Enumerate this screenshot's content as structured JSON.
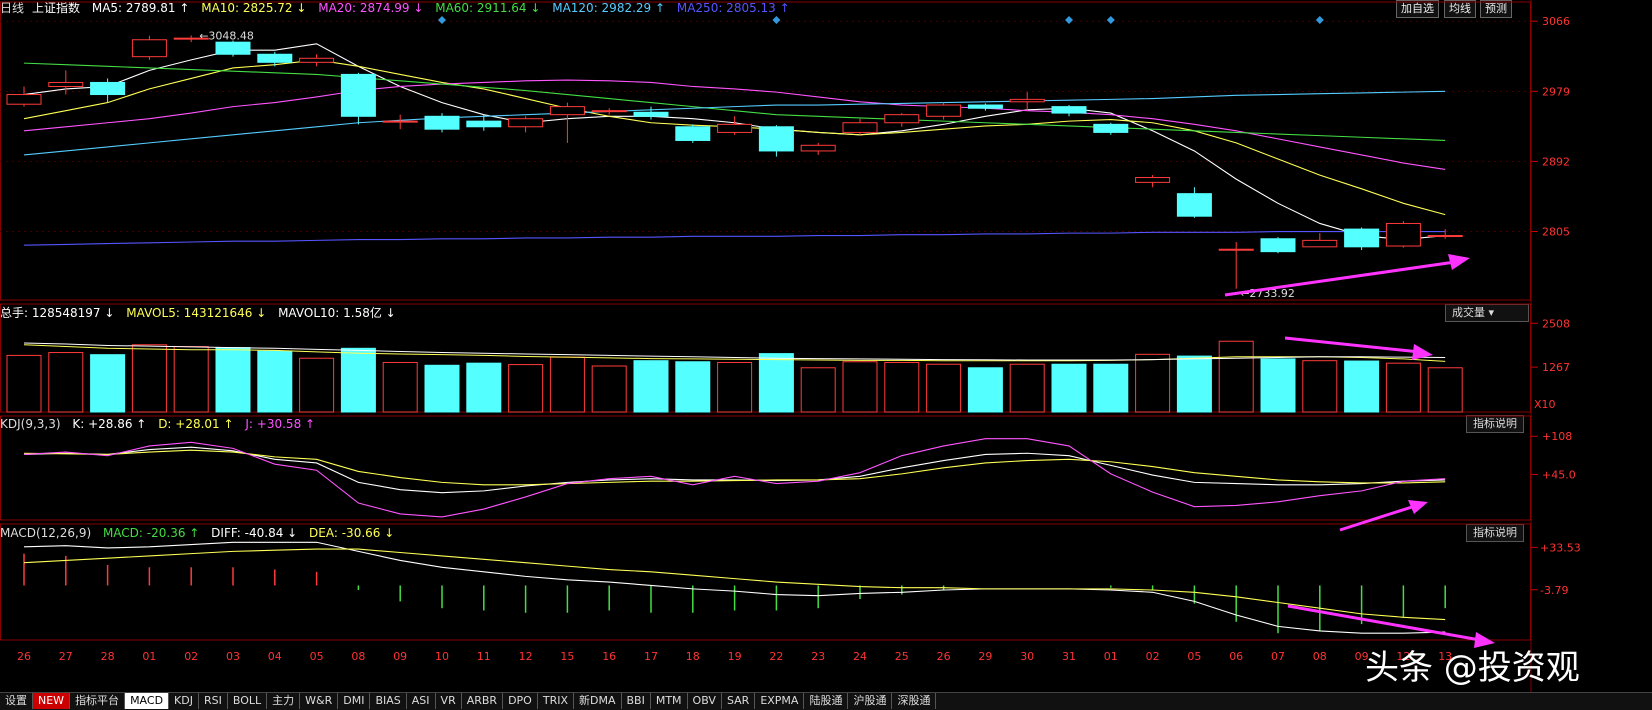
{
  "top_buttons": [
    "加自选",
    "均线",
    "预测"
  ],
  "panels": {
    "price": {
      "label": "日线",
      "name": "上证指数",
      "ma": [
        {
          "name": "MA5",
          "value": "2789.81",
          "dir": "↑",
          "color": "#ffffff"
        },
        {
          "name": "MA10",
          "value": "2825.72",
          "dir": "↓",
          "color": "#ffff55"
        },
        {
          "name": "MA20",
          "value": "2874.99",
          "dir": "↓",
          "color": "#ff55ff"
        },
        {
          "name": "MA60",
          "value": "2911.64",
          "dir": "↓",
          "color": "#44dd44"
        },
        {
          "name": "MA120",
          "value": "2982.29",
          "dir": "↑",
          "color": "#55ccff"
        },
        {
          "name": "MA250",
          "value": "2805.13",
          "dir": "↑",
          "color": "#5555ff"
        }
      ],
      "axis_labels": [
        "3066",
        "2979",
        "2892",
        "2805"
      ],
      "high_label": "3048.48",
      "low_label": "2733.92"
    },
    "volume": {
      "items": [
        {
          "name": "总手",
          "value": "128548197",
          "dir": "↓",
          "color": "#ffffff"
        },
        {
          "name": "MAVOL5",
          "value": "143121646",
          "dir": "↓",
          "color": "#ffff55"
        },
        {
          "name": "MAVOL10",
          "value": "1.58亿",
          "dir": "↓",
          "color": "#ffffff"
        }
      ],
      "axis_labels": [
        "2508",
        "1267"
      ],
      "unit": "X10",
      "button": "成交量"
    },
    "kdj": {
      "label": "KDJ(9,3,3)",
      "items": [
        {
          "name": "K",
          "value": "+28.86",
          "dir": "↑",
          "color": "#ffffff"
        },
        {
          "name": "D",
          "value": "+28.01",
          "dir": "↑",
          "color": "#ffff55"
        },
        {
          "name": "J",
          "value": "+30.58",
          "dir": "↑",
          "color": "#ff55ff"
        }
      ],
      "axis_labels": [
        "+108",
        "+45.0"
      ],
      "button": "指标说明"
    },
    "macd": {
      "label": "MACD(12,26,9)",
      "items": [
        {
          "name": "MACD",
          "value": "-20.36",
          "dir": "↑",
          "color": "#44dd44"
        },
        {
          "name": "DIFF",
          "value": "-40.84",
          "dir": "↓",
          "color": "#ffffff"
        },
        {
          "name": "DEA",
          "value": "-30.66",
          "dir": "↓",
          "color": "#ffff55"
        }
      ],
      "axis_labels": [
        "+33.53",
        "-3.79"
      ],
      "button": "指标说明"
    }
  },
  "chart_data": {
    "type": "candlestick",
    "x": [
      "26",
      "27",
      "28",
      "01",
      "02",
      "03",
      "04",
      "05",
      "08",
      "09",
      "10",
      "11",
      "12",
      "15",
      "16",
      "17",
      "18",
      "19",
      "22",
      "23",
      "24",
      "25",
      "26",
      "29",
      "30",
      "31",
      "01",
      "02",
      "05",
      "06",
      "07",
      "08",
      "09",
      "12",
      "13"
    ],
    "ohlc": [
      [
        2963,
        2975,
        2960,
        2985
      ],
      [
        2985,
        2990,
        2975,
        3005
      ],
      [
        2990,
        2975,
        2965,
        2995
      ],
      [
        3022,
        3043,
        3018,
        3048
      ],
      [
        3045,
        3045,
        3040,
        3048.48
      ],
      [
        3040,
        3025,
        3022,
        3042
      ],
      [
        3025,
        3015,
        3010,
        3028
      ],
      [
        3015,
        3020,
        3010,
        3025
      ],
      [
        3000,
        2948,
        2938,
        3002
      ],
      [
        2942,
        2942,
        2932,
        2950
      ],
      [
        2948,
        2932,
        2928,
        2952
      ],
      [
        2942,
        2935,
        2930,
        2950
      ],
      [
        2935,
        2945,
        2928,
        2948
      ],
      [
        2950,
        2960,
        2915,
        2965
      ],
      [
        2955,
        2955,
        2950,
        2958
      ],
      [
        2953,
        2948,
        2944,
        2960
      ],
      [
        2935,
        2918,
        2915,
        2938
      ],
      [
        2928,
        2938,
        2925,
        2948
      ],
      [
        2935,
        2905,
        2898,
        2937
      ],
      [
        2905,
        2912,
        2900,
        2915
      ],
      [
        2928,
        2940,
        2925,
        2945
      ],
      [
        2940,
        2950,
        2935,
        2952
      ],
      [
        2948,
        2962,
        2944,
        2965
      ],
      [
        2962,
        2958,
        2955,
        2964
      ],
      [
        2966,
        2969,
        2955,
        2978
      ],
      [
        2960,
        2952,
        2948,
        2962
      ],
      [
        2938,
        2928,
        2925,
        2940
      ],
      [
        2866,
        2872,
        2860,
        2875
      ],
      [
        2852,
        2824,
        2822,
        2860
      ],
      [
        2783,
        2783,
        2733.92,
        2792
      ],
      [
        2796,
        2780,
        2778,
        2798
      ],
      [
        2786,
        2794,
        2786,
        2803
      ],
      [
        2808,
        2786,
        2782,
        2810
      ],
      [
        2787,
        2815,
        2785,
        2818
      ],
      [
        2800,
        2800,
        2796,
        2808
      ]
    ],
    "ma5": [
      2975,
      2982,
      2985,
      3005,
      3018,
      3030,
      3030,
      3038,
      3010,
      2985,
      2965,
      2950,
      2940,
      2945,
      2948,
      2948,
      2945,
      2940,
      2932,
      2928,
      2925,
      2930,
      2938,
      2948,
      2956,
      2958,
      2952,
      2930,
      2905,
      2870,
      2840,
      2815,
      2800,
      2795,
      2800
    ],
    "ma10": [
      2945,
      2955,
      2965,
      2982,
      2995,
      3008,
      3012,
      3018,
      3010,
      3000,
      2990,
      2982,
      2970,
      2958,
      2948,
      2940,
      2937,
      2935,
      2932,
      2928,
      2925,
      2928,
      2932,
      2936,
      2938,
      2942,
      2944,
      2940,
      2930,
      2915,
      2895,
      2875,
      2858,
      2840,
      2826
    ],
    "ma20": [
      2930,
      2935,
      2940,
      2945,
      2952,
      2960,
      2965,
      2972,
      2980,
      2985,
      2988,
      2990,
      2992,
      2993,
      2992,
      2990,
      2985,
      2982,
      2978,
      2972,
      2966,
      2962,
      2960,
      2958,
      2955,
      2953,
      2950,
      2945,
      2938,
      2930,
      2920,
      2910,
      2900,
      2890,
      2882
    ],
    "ma60": [
      3014,
      3012,
      3010,
      3008,
      3006,
      3004,
      3002,
      3000,
      2996,
      2992,
      2988,
      2984,
      2980,
      2975,
      2970,
      2965,
      2960,
      2955,
      2950,
      2948,
      2946,
      2944,
      2942,
      2940,
      2938,
      2936,
      2934,
      2932,
      2930,
      2928,
      2926,
      2924,
      2922,
      2920,
      2918
    ],
    "ma120": [
      2900,
      2905,
      2910,
      2915,
      2920,
      2925,
      2930,
      2935,
      2940,
      2943,
      2946,
      2948,
      2950,
      2952,
      2954,
      2956,
      2958,
      2960,
      2962,
      2962,
      2963,
      2964,
      2965,
      2966,
      2967,
      2968,
      2969,
      2970,
      2972,
      2974,
      2975,
      2976,
      2977,
      2978,
      2979
    ],
    "ma250": [
      2788,
      2789,
      2790,
      2791,
      2792,
      2793,
      2793,
      2794,
      2795,
      2795,
      2796,
      2796,
      2797,
      2797,
      2798,
      2798,
      2799,
      2799,
      2799,
      2800,
      2800,
      2801,
      2801,
      2802,
      2802,
      2803,
      2803,
      2804,
      2804,
      2804,
      2805,
      2805,
      2805,
      2805,
      2805
    ],
    "volume": [
      1600,
      1680,
      1620,
      1900,
      1850,
      1820,
      1720,
      1520,
      1800,
      1400,
      1320,
      1380,
      1340,
      1550,
      1300,
      1450,
      1420,
      1400,
      1650,
      1250,
      1420,
      1400,
      1350,
      1250,
      1350,
      1350,
      1350,
      1630,
      1580,
      2000,
      1500,
      1450,
      1440,
      1380,
      1250
    ],
    "mavol5": [
      1900,
      1850,
      1800,
      1780,
      1760,
      1760,
      1740,
      1700,
      1660,
      1640,
      1620,
      1600,
      1570,
      1550,
      1530,
      1510,
      1500,
      1490,
      1480,
      1470,
      1460,
      1460,
      1450,
      1450,
      1450,
      1450,
      1460,
      1480,
      1520,
      1560,
      1560,
      1560,
      1540,
      1500,
      1430
    ],
    "mavol10": [
      1950,
      1920,
      1880,
      1860,
      1840,
      1820,
      1800,
      1770,
      1740,
      1710,
      1680,
      1660,
      1640,
      1620,
      1600,
      1580,
      1560,
      1540,
      1520,
      1510,
      1500,
      1490,
      1480,
      1475,
      1470,
      1470,
      1470,
      1480,
      1500,
      1520,
      1540,
      1560,
      1560,
      1550,
      1540
    ],
    "k": [
      78,
      80,
      78,
      86,
      90,
      84,
      70,
      64,
      32,
      20,
      15,
      18,
      26,
      32,
      36,
      38,
      36,
      36,
      35,
      36,
      42,
      56,
      68,
      78,
      80,
      76,
      60,
      44,
      32,
      30,
      28,
      28,
      30,
      34,
      36
    ],
    "d": [
      80,
      79,
      78,
      82,
      85,
      82,
      74,
      70,
      50,
      40,
      32,
      28,
      28,
      30,
      32,
      34,
      34,
      35,
      36,
      36,
      38,
      46,
      56,
      64,
      68,
      70,
      66,
      58,
      48,
      42,
      36,
      33,
      31,
      31,
      33
    ],
    "j": [
      78,
      82,
      76,
      92,
      98,
      88,
      62,
      52,
      -2,
      -20,
      -25,
      -12,
      8,
      30,
      38,
      42,
      28,
      42,
      30,
      34,
      48,
      76,
      92,
      104,
      104,
      92,
      46,
      16,
      -8,
      -6,
      0,
      10,
      18,
      34,
      38
    ],
    "dif": [
      34,
      35,
      33,
      34,
      36,
      38,
      38,
      38,
      30,
      22,
      16,
      12,
      8,
      5,
      3,
      0,
      -3,
      -5,
      -8,
      -9,
      -7,
      -6,
      -4,
      -3,
      -3,
      -3,
      -4,
      -6,
      -14,
      -26,
      -36,
      -40,
      -42,
      -42,
      -41
    ],
    "dea": [
      20,
      22,
      24,
      26,
      28,
      30,
      31,
      32,
      32,
      29,
      26,
      23,
      20,
      17,
      14,
      12,
      9,
      6,
      3,
      1,
      -1,
      -2,
      -2,
      -3,
      -3,
      -3,
      -3,
      -4,
      -6,
      -10,
      -15,
      -20,
      -25,
      -28,
      -30
    ],
    "macd_hist": [
      28,
      26,
      18,
      16,
      16,
      16,
      14,
      12,
      -4,
      -14,
      -20,
      -22,
      -24,
      -24,
      -22,
      -24,
      -24,
      -22,
      -22,
      -20,
      -12,
      -8,
      -4,
      0,
      0,
      0,
      -2,
      -4,
      -16,
      -32,
      -42,
      -40,
      -34,
      -28,
      -20
    ]
  }
}
